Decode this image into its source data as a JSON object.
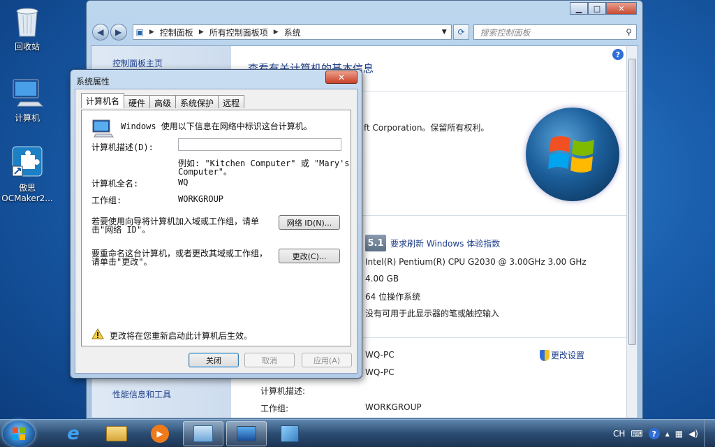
{
  "desktop": {
    "icons": [
      {
        "label": "回收站"
      },
      {
        "label": "计算机"
      },
      {
        "label": "傲思",
        "label2": "OCMaker2..."
      }
    ]
  },
  "control_panel": {
    "breadcrumb": [
      "控制面板",
      "所有控制面板项",
      "系统"
    ],
    "search_placeholder": "搜索控制面板",
    "left_links": {
      "home": "控制面板主页",
      "performance": "性能信息和工具"
    },
    "heading": "查看有关计算机的基本信息",
    "copyright_fragment": "ft Corporation。保留所有权利。",
    "score": "5.1",
    "score_link": "要求刷新 Windows 体验指数",
    "processor": "Intel(R) Pentium(R) CPU G2030 @ 3.00GHz   3.00 GHz",
    "memory": "4.00 GB",
    "system_type": "64 位操作系统",
    "pen_touch": "没有可用于此显示器的笔或触控输入",
    "computer_name": "WQ-PC",
    "full_name": "WQ-PC",
    "description_label": "计算机描述:",
    "workgroup_label": "工作组:",
    "workgroup": "WORKGROUP",
    "change_settings": "更改设置"
  },
  "dialog": {
    "title": "系统属性",
    "close_glyph": "✕",
    "tabs": [
      "计算机名",
      "硬件",
      "高级",
      "系统保护",
      "远程"
    ],
    "intro": "Windows 使用以下信息在网络中标识这台计算机。",
    "desc_label": "计算机描述(D):",
    "example_line1": "例如: \"Kitchen Computer\" 或 \"Mary's",
    "example_line2": "Computer\"。",
    "fullname_label": "计算机全名:",
    "fullname_value": "WQ",
    "workgroup_label": "工作组:",
    "workgroup_value": "WORKGROUP",
    "netid_text1": "若要使用向导将计算机加入域或工作组，请单",
    "netid_text2": "击\"网络 ID\"。",
    "netid_button": "网络 ID(N)...",
    "rename_text1": "要重命名这台计算机，或者更改其域或工作组，",
    "rename_text2": "请单击\"更改\"。",
    "change_button": "更改(C)...",
    "warning": "更改将在您重新启动此计算机后生效。",
    "ok_button": "关闭",
    "cancel_button": "取消",
    "apply_button": "应用(A)"
  },
  "taskbar": {
    "lang": "CH"
  }
}
